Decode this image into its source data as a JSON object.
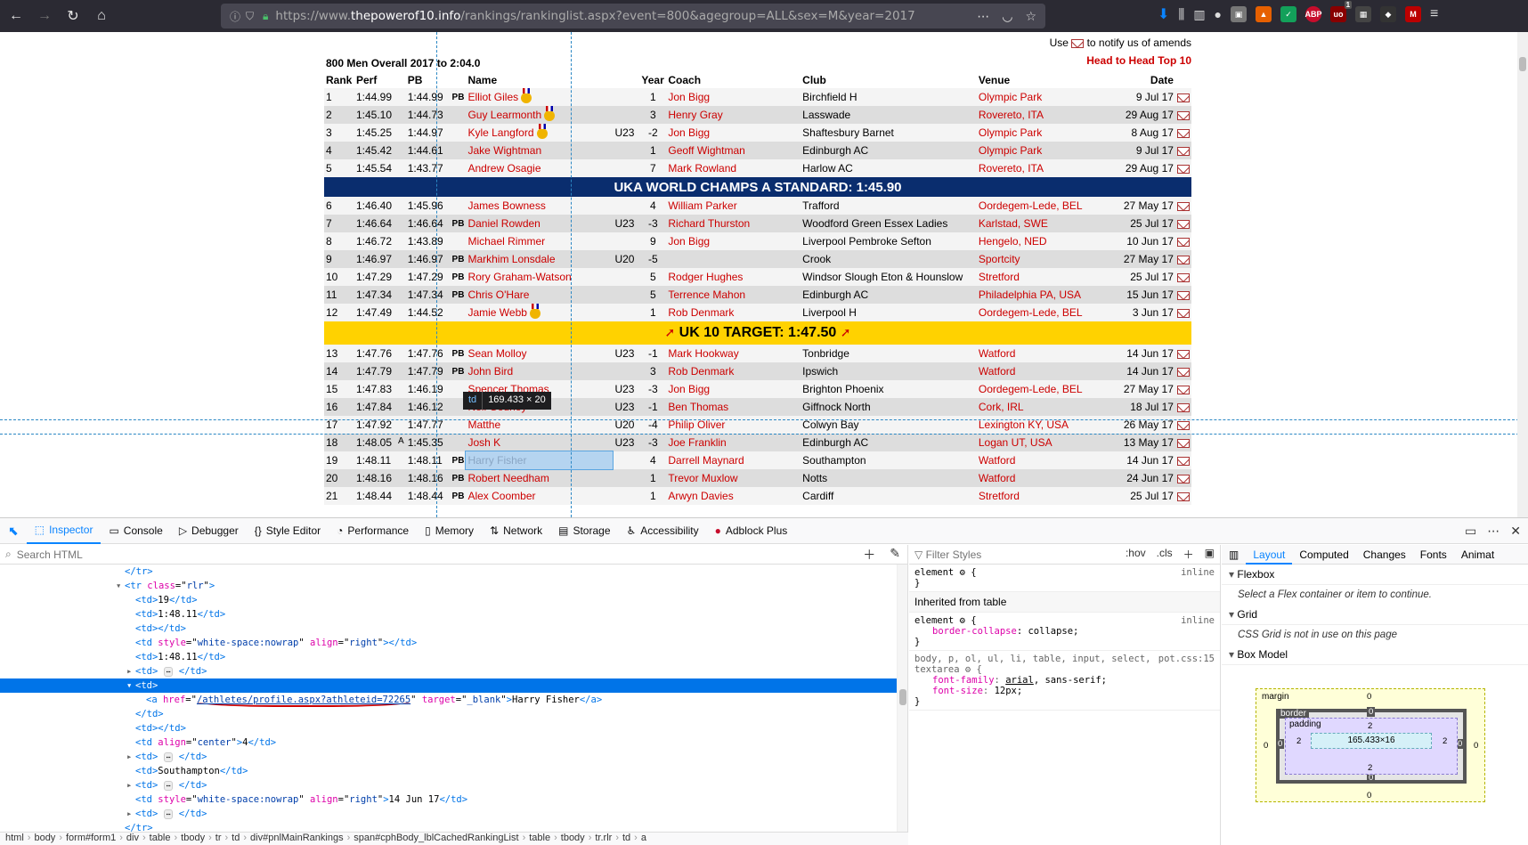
{
  "browser": {
    "url_prefix": "https://www.",
    "url_domain": "thepowerof10.info",
    "url_path": "/rankings/rankinglist.aspx?event=800&agegroup=ALL&sex=M&year=2017",
    "more_icon": "⋯",
    "pocket_icon": "pocket-icon",
    "star_icon": "☆",
    "badge_count": "1"
  },
  "page": {
    "notify_prefix": "Use",
    "notify_suffix": "to notify us of amends",
    "head_to_head": "Head to Head Top 10",
    "list_title": "800 Men Overall 2017 to 2:04.0",
    "headers": {
      "rank": "Rank",
      "perf": "Perf",
      "pb": "PB",
      "name": "Name",
      "year": "Year",
      "coach": "Coach",
      "club": "Club",
      "venue": "Venue",
      "date": "Date"
    },
    "banner_world": "UKA WORLD CHAMPS A STANDARD: 1:45.90",
    "banner_target": "UK 10 TARGET: 1:47.50",
    "rows_a": [
      {
        "rank": "1",
        "perf": "1:44.99",
        "pb": "1:44.99",
        "pbflag": "PB",
        "name": "Elliot Giles",
        "medal": true,
        "ag": "",
        "year": "1",
        "coach": "Jon Bigg",
        "club": "Birchfield H",
        "venue": "Olympic Park",
        "date": "9 Jul 17"
      },
      {
        "rank": "2",
        "perf": "1:45.10",
        "pb": "1:44.73",
        "pbflag": "",
        "name": "Guy Learmonth",
        "medal": true,
        "ag": "",
        "year": "3",
        "coach": "Henry Gray",
        "club": "Lasswade",
        "venue": "Rovereto, ITA",
        "date": "29 Aug 17"
      },
      {
        "rank": "3",
        "perf": "1:45.25",
        "pb": "1:44.97",
        "pbflag": "",
        "name": "Kyle Langford",
        "medal": true,
        "ag": "U23",
        "year": "-2",
        "coach": "Jon Bigg",
        "club": "Shaftesbury Barnet",
        "venue": "Olympic Park",
        "date": "8 Aug 17"
      },
      {
        "rank": "4",
        "perf": "1:45.42",
        "pb": "1:44.61",
        "pbflag": "",
        "name": "Jake Wightman",
        "medal": false,
        "ag": "",
        "year": "1",
        "coach": "Geoff Wightman",
        "club": "Edinburgh AC",
        "venue": "Olympic Park",
        "date": "9 Jul 17"
      },
      {
        "rank": "5",
        "perf": "1:45.54",
        "pb": "1:43.77",
        "pbflag": "",
        "name": "Andrew Osagie",
        "medal": false,
        "ag": "",
        "year": "7",
        "coach": "Mark Rowland",
        "club": "Harlow AC",
        "venue": "Rovereto, ITA",
        "date": "29 Aug 17"
      }
    ],
    "rows_b": [
      {
        "rank": "6",
        "perf": "1:46.40",
        "pb": "1:45.96",
        "pbflag": "",
        "name": "James Bowness",
        "medal": false,
        "ag": "",
        "year": "4",
        "coach": "William Parker",
        "club": "Trafford",
        "venue": "Oordegem-Lede, BEL",
        "date": "27 May 17"
      },
      {
        "rank": "7",
        "perf": "1:46.64",
        "pb": "1:46.64",
        "pbflag": "PB",
        "name": "Daniel Rowden",
        "medal": false,
        "ag": "U23",
        "year": "-3",
        "coach": "Richard Thurston",
        "club": "Woodford Green Essex Ladies",
        "venue": "Karlstad, SWE",
        "date": "25 Jul 17"
      },
      {
        "rank": "8",
        "perf": "1:46.72",
        "pb": "1:43.89",
        "pbflag": "",
        "name": "Michael Rimmer",
        "medal": false,
        "ag": "",
        "year": "9",
        "coach": "Jon Bigg",
        "club": "Liverpool Pembroke Sefton",
        "venue": "Hengelo, NED",
        "date": "10 Jun 17"
      },
      {
        "rank": "9",
        "perf": "1:46.97",
        "pb": "1:46.97",
        "pbflag": "PB",
        "name": "Markhim Lonsdale",
        "medal": false,
        "ag": "U20",
        "year": "-5",
        "coach": "",
        "club": "Crook",
        "venue": "Sportcity",
        "date": "27 May 17"
      },
      {
        "rank": "10",
        "perf": "1:47.29",
        "pb": "1:47.29",
        "pbflag": "PB",
        "name": "Rory Graham-Watson",
        "medal": false,
        "ag": "",
        "year": "5",
        "coach": "Rodger Hughes",
        "club": "Windsor Slough Eton & Hounslow",
        "venue": "Stretford",
        "date": "25 Jul 17"
      },
      {
        "rank": "11",
        "perf": "1:47.34",
        "pb": "1:47.34",
        "pbflag": "PB",
        "name": "Chris O'Hare",
        "medal": false,
        "ag": "",
        "year": "5",
        "coach": "Terrence Mahon",
        "club": "Edinburgh AC",
        "venue": "Philadelphia PA, USA",
        "date": "15 Jun 17"
      },
      {
        "rank": "12",
        "perf": "1:47.49",
        "pb": "1:44.52",
        "pbflag": "",
        "name": "Jamie Webb",
        "medal": true,
        "ag": "",
        "year": "1",
        "coach": "Rob Denmark",
        "club": "Liverpool H",
        "venue": "Oordegem-Lede, BEL",
        "date": "3 Jun 17"
      }
    ],
    "rows_c": [
      {
        "rank": "13",
        "perf": "1:47.76",
        "pb": "1:47.76",
        "pbflag": "PB",
        "name": "Sean Molloy",
        "medal": false,
        "ag": "U23",
        "year": "-1",
        "coach": "Mark Hookway",
        "club": "Tonbridge",
        "venue": "Watford",
        "date": "14 Jun 17"
      },
      {
        "rank": "14",
        "perf": "1:47.79",
        "pb": "1:47.79",
        "pbflag": "PB",
        "name": "John Bird",
        "medal": false,
        "ag": "",
        "year": "3",
        "coach": "Rob Denmark",
        "club": "Ipswich",
        "venue": "Watford",
        "date": "14 Jun 17"
      },
      {
        "rank": "15",
        "perf": "1:47.83",
        "pb": "1:46.19",
        "pbflag": "",
        "name": "Spencer Thomas",
        "medal": false,
        "ag": "U23",
        "year": "-3",
        "coach": "Jon Bigg",
        "club": "Brighton Phoenix",
        "venue": "Oordegem-Lede, BEL",
        "date": "27 May 17"
      },
      {
        "rank": "16",
        "perf": "1:47.84",
        "pb": "1:46.12",
        "pbflag": "",
        "name": "Neil Gourley",
        "medal": false,
        "ag": "U23",
        "year": "-1",
        "coach": "Ben Thomas",
        "club": "Giffnock North",
        "venue": "Cork, IRL",
        "date": "18 Jul 17"
      },
      {
        "rank": "17",
        "perf": "1:47.92",
        "pb": "1:47.77",
        "pbflag": "",
        "name": "Matthe",
        "medal": false,
        "ag": "U20",
        "year": "-4",
        "coach": "Philip Oliver",
        "club": "Colwyn Bay",
        "venue": "Lexington KY, USA",
        "date": "26 May 17"
      },
      {
        "rank": "18",
        "perf": "1:48.05",
        "perfA": "A",
        "pb": "1:45.35",
        "pbflag": "",
        "name": "Josh K",
        "medal": false,
        "ag": "U23",
        "year": "-3",
        "coach": "Joe Franklin",
        "club": "Edinburgh AC",
        "venue": "Logan UT, USA",
        "date": "13 May 17"
      },
      {
        "rank": "19",
        "perf": "1:48.11",
        "pb": "1:48.11",
        "pbflag": "PB",
        "name": "Harry Fisher",
        "medal": false,
        "ag": "",
        "year": "4",
        "coach": "Darrell Maynard",
        "club": "Southampton",
        "venue": "Watford",
        "date": "14 Jun 17",
        "selected": true
      },
      {
        "rank": "20",
        "perf": "1:48.16",
        "pb": "1:48.16",
        "pbflag": "PB",
        "name": "Robert Needham",
        "medal": false,
        "ag": "",
        "year": "1",
        "coach": "Trevor Muxlow",
        "club": "Notts",
        "venue": "Watford",
        "date": "24 Jun 17"
      },
      {
        "rank": "21",
        "perf": "1:48.44",
        "pb": "1:48.44",
        "pbflag": "PB",
        "name": "Alex Coomber",
        "medal": false,
        "ag": "",
        "year": "1",
        "coach": "Arwyn Davies",
        "club": "Cardiff",
        "venue": "Stretford",
        "date": "25 Jul 17"
      }
    ]
  },
  "tooltip": {
    "tag": "td",
    "size": "169.433 × 20"
  },
  "devtools": {
    "tabs": [
      {
        "label": "Inspector",
        "name": "tab-inspector",
        "icon": "inspector-icon",
        "glyph": "⬚",
        "active": true
      },
      {
        "label": "Console",
        "name": "tab-console",
        "icon": "console-icon",
        "glyph": "▭"
      },
      {
        "label": "Debugger",
        "name": "tab-debugger",
        "icon": "debugger-icon",
        "glyph": "▷"
      },
      {
        "label": "Style Editor",
        "name": "tab-style-editor",
        "icon": "style-editor-icon",
        "glyph": "{}"
      },
      {
        "label": "Performance",
        "name": "tab-performance",
        "icon": "performance-icon",
        "glyph": "◔"
      },
      {
        "label": "Memory",
        "name": "tab-memory",
        "icon": "memory-icon",
        "glyph": "▯"
      },
      {
        "label": "Network",
        "name": "tab-network",
        "icon": "network-icon",
        "glyph": "⇅"
      },
      {
        "label": "Storage",
        "name": "tab-storage",
        "icon": "storage-icon",
        "glyph": "▤"
      },
      {
        "label": "Accessibility",
        "name": "tab-accessibility",
        "icon": "accessibility-icon",
        "glyph": "♿"
      },
      {
        "label": "Adblock Plus",
        "name": "tab-adblock-plus",
        "icon": "adblock-icon",
        "glyph": "●"
      }
    ],
    "search_html_placeholder": "Search HTML",
    "filter_styles_placeholder": "Filter Styles",
    "hov": ":hov",
    "cls": ".cls",
    "layout_tabs": [
      "Layout",
      "Computed",
      "Changes",
      "Fonts",
      "Animat"
    ],
    "flexbox_title": "Flexbox",
    "flexbox_msg": "Select a Flex container or item to continue.",
    "grid_title": "Grid",
    "grid_msg": "CSS Grid is not in use on this page",
    "boxmodel_title": "Box Model",
    "boxmodel": {
      "margin": "margin",
      "border": "border",
      "padding": "padding",
      "content": "165.433×16",
      "m_top": "0",
      "m_bottom": "0",
      "m_left": "0",
      "m_right": "0",
      "b_top": "0",
      "b_bottom": "0",
      "b_left": "0",
      "b_right": "0",
      "p_top": "2",
      "p_bottom": "2",
      "p_left": "2",
      "p_right": "2"
    },
    "rules": {
      "r1_sel": "element",
      "r1_src": "inline",
      "inherited": "Inherited from table",
      "r2_sel": "element",
      "r2_src": "inline",
      "r2_prop": "border-collapse",
      "r2_val": "collapse;",
      "r3_sel": "body, p, ol, ul, li, table, input, select,",
      "r3_sel2": "textarea",
      "r3_src": "pot.css:15",
      "r3_p1": "font-family",
      "r3_v1a": "arial",
      "r3_v1b": ", sans-serif;",
      "r3_p2": "font-size",
      "r3_v2": "12px;"
    },
    "breadcrumbs": [
      "html",
      "body",
      "form#form1",
      "div",
      "table",
      "tbody",
      "tr",
      "td",
      "div#pnlMainRankings",
      "span#cphBody_lblCachedRankingList",
      "table",
      "tbody",
      "tr.rlr",
      "td",
      "a"
    ],
    "tree": {
      "l0": "</tr>",
      "l1_tag": "tr",
      "l1_attr": "class",
      "l1_val": "rlr",
      "l2": "19",
      "l3": "1:48.11",
      "l5_attr1": "style",
      "l5_val1": "white-space:nowrap",
      "l5_attr2": "align",
      "l5_val2": "right",
      "l6": "1:48.11",
      "a_href": "/athletes/profile.aspx?athleteid=72265",
      "a_target": "_blank",
      "a_text": "Harry Fisher",
      "center_val": "4",
      "club_val": "Southampton",
      "date_val": "14 Jun 17"
    }
  }
}
